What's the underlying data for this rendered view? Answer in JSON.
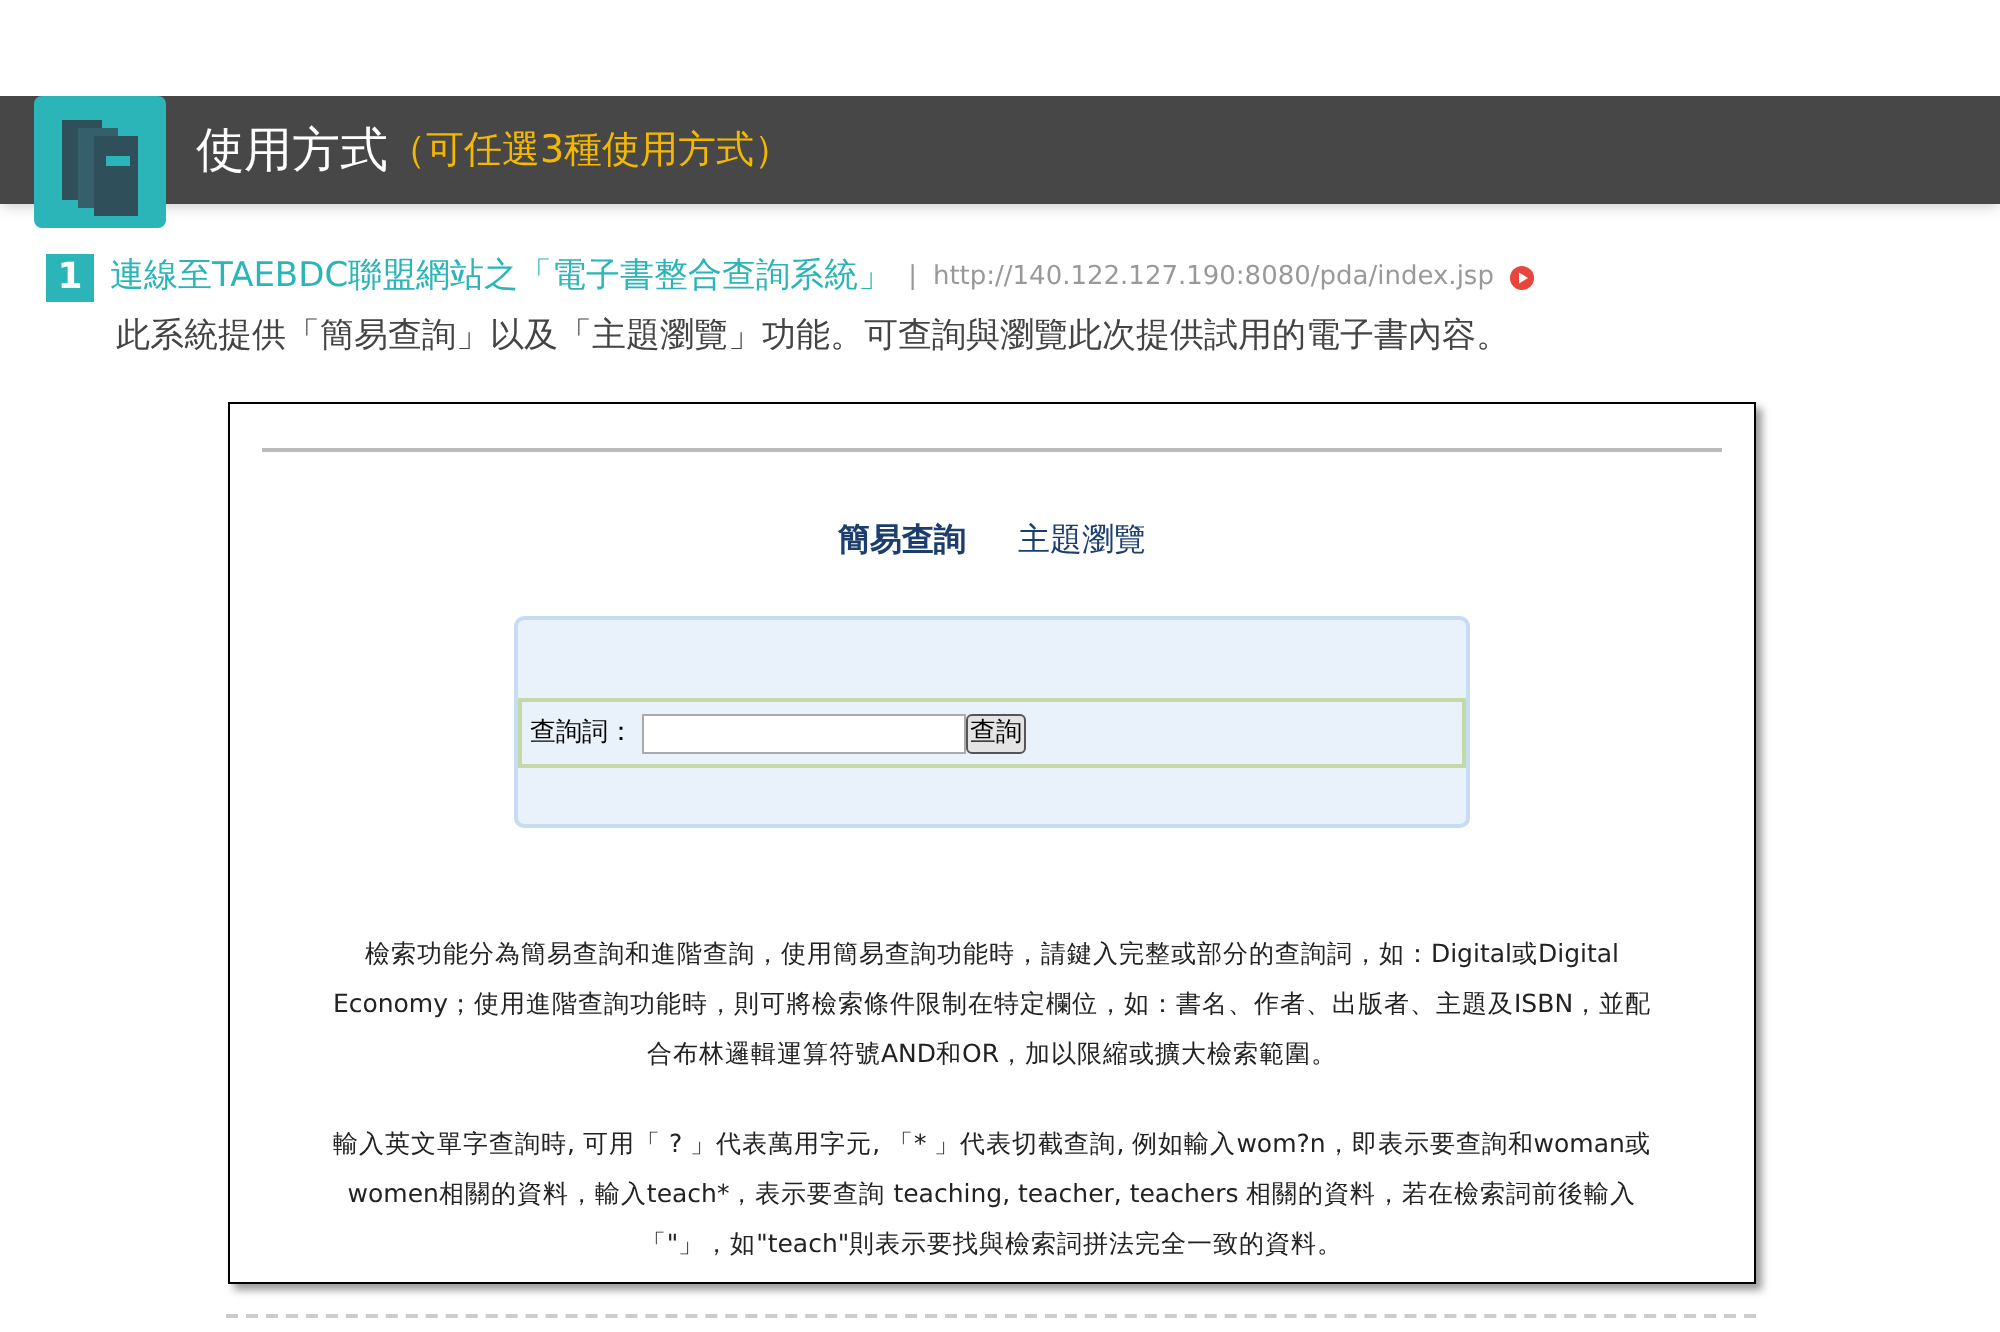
{
  "header": {
    "title": "使用方式",
    "subtitle": "（可任選3種使用方式）"
  },
  "step": {
    "number": "1",
    "title": "連線至TAEBDC聯盟網站之「電子書整合查詢系統」",
    "separator": "|",
    "url": "http://140.122.127.190:8080/pda/index.jsp",
    "description": "此系統提供「簡易查詢」以及「主題瀏覽」功能。可查詢與瀏覽此次提供試用的電子書內容。"
  },
  "screenshot": {
    "tabs": [
      {
        "label": "簡易查詢",
        "selected": true
      },
      {
        "label": "主題瀏覽",
        "selected": false
      }
    ],
    "search": {
      "label": "查詢詞：",
      "button": "查詢"
    },
    "paragraphs": [
      "檢索功能分為簡易查詢和進階查詢，使用簡易查詢功能時，請鍵入完整或部分的查詢詞，如：Digital或Digital Economy；使用進階查詢功能時，則可將檢索條件限制在特定欄位，如：書名、作者、出版者、主題及ISBN，並配合布林邏輯運算符號AND和OR，加以限縮或擴大檢索範圍。",
      "輸入英文單字查詢時, 可用「 ? 」代表萬用字元, 「* 」代表切截查詢, 例如輸入wom?n，即表示要查詢和woman或 women相關的資料，輸入teach*，表示要查詢 teaching, teacher, teachers 相關的資料，若在檢索詞前後輸入「\"」，如\"teach\"則表示要找與檢索詞拼法完全一致的資料。"
    ]
  }
}
